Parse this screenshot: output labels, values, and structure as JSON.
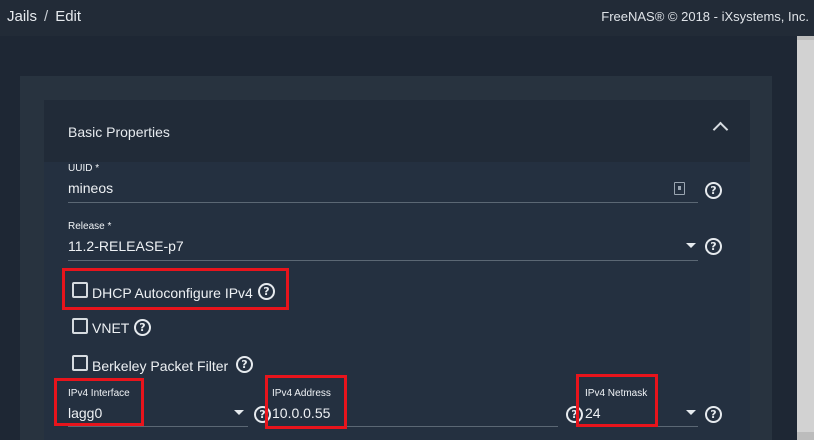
{
  "breadcrumb": {
    "parent": "Jails",
    "separator": "/",
    "current": "Edit"
  },
  "copyright": "FreeNAS® © 2018 - iXsystems, Inc.",
  "section": {
    "title": "Basic Properties"
  },
  "fields": {
    "uuid": {
      "label": "UUID *",
      "value": "mineos"
    },
    "release": {
      "label": "Release *",
      "value": "11.2-RELEASE-p7"
    },
    "dhcp": {
      "label": "DHCP Autoconfigure IPv4",
      "checked": false
    },
    "vnet": {
      "label": "VNET",
      "checked": false
    },
    "bpf": {
      "label": "Berkeley Packet Filter",
      "checked": false
    },
    "ipv4_interface": {
      "label": "IPv4 Interface",
      "value": "lagg0"
    },
    "ipv4_address": {
      "label": "IPv4 Address",
      "value": "10.0.0.55"
    },
    "ipv4_netmask": {
      "label": "IPv4 Netmask",
      "value": "24"
    }
  },
  "help_glyph": "?",
  "colors": {
    "highlight": "#e8141c",
    "background": "#1e2734",
    "card": "#243040"
  }
}
